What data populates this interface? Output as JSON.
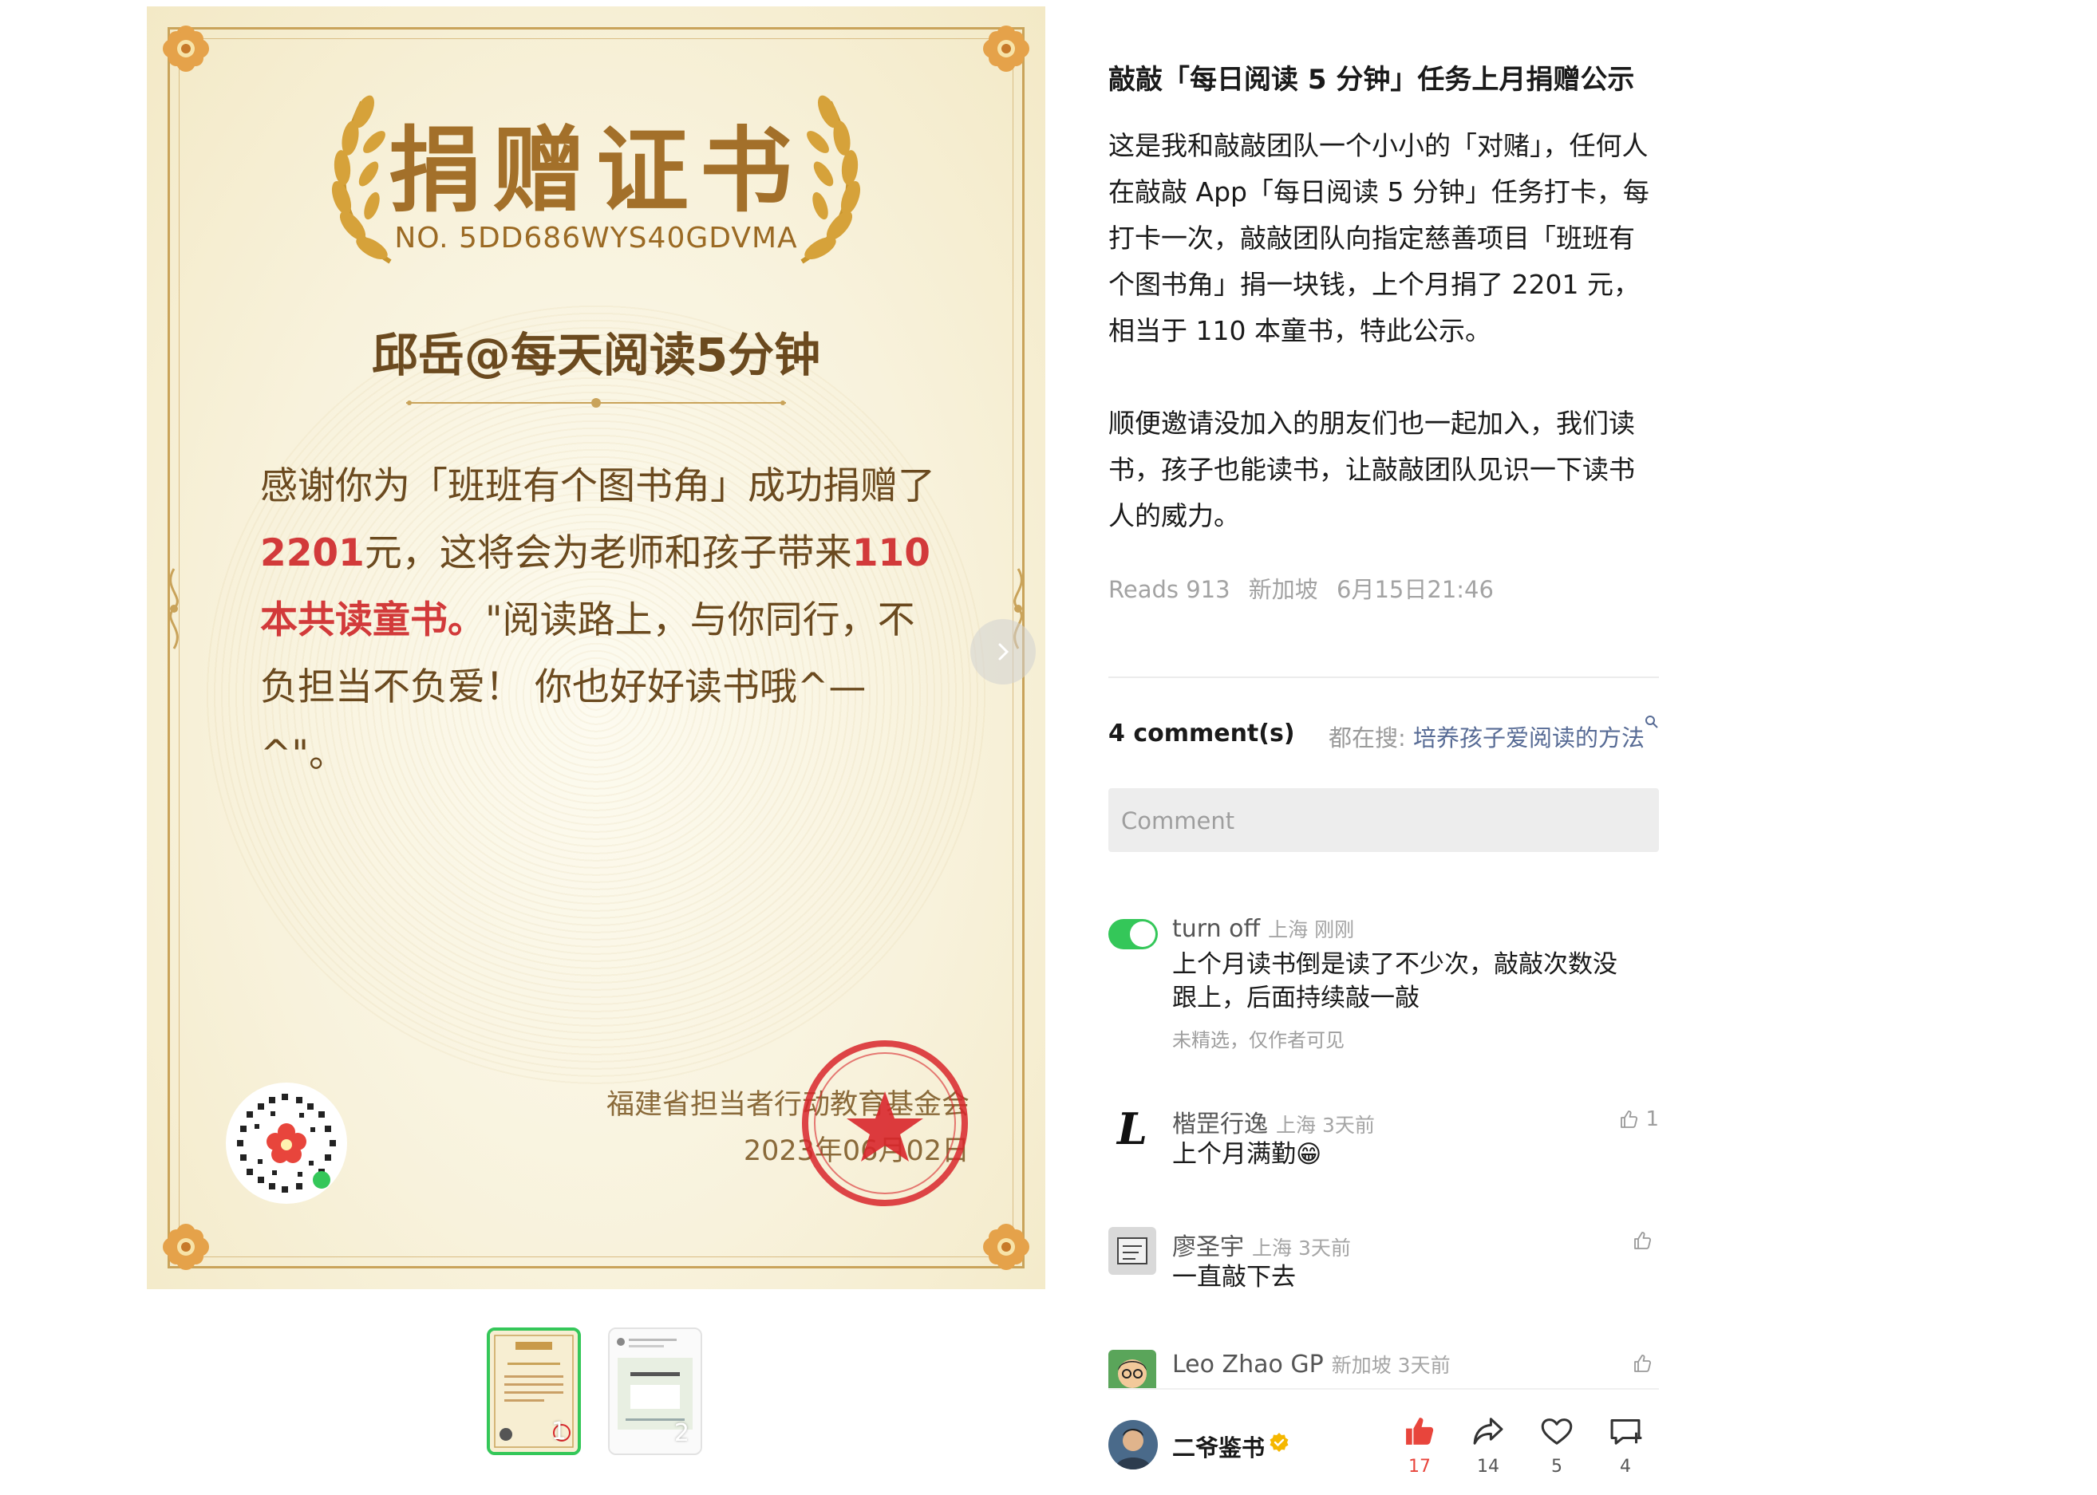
{
  "certificate": {
    "title": "捐赠证书",
    "number": "NO. 5DD686WYS40GDVMA",
    "recipient": "邱岳@每天阅读5分钟",
    "body_1": "感谢你为「班班有个图书角」成功捐赠了",
    "amount": "2201",
    "body_2": "元，这将会为老师和孩子带来",
    "books": "110本共读童书。",
    "body_3": "\"阅读路上，与你同行，不负担当不负爱！ 你也好好读书哦^—^\"。",
    "org": "福建省担当者行动教育基金会",
    "date": "2023年06月02日",
    "colors": {
      "gold": "#a3702a",
      "red": "#d23a3a"
    }
  },
  "thumbnails": [
    {
      "index": "1",
      "active": true
    },
    {
      "index": "2",
      "active": false
    }
  ],
  "post": {
    "title": "敲敲「每日阅读 5 分钟」任务上月捐赠公示",
    "paragraph_1": "这是我和敲敲团队一个小小的「对赌」，任何人在敲敲 App「每日阅读 5 分钟」任务打卡，每打卡一次，敲敲团队向指定慈善项目「班班有个图书角」捐一块钱，上个月捐了 2201 元，相当于 110 本童书，特此公示。",
    "paragraph_2": "顺便邀请没加入的朋友们也一起加入，我们读书，孩子也能读书，让敲敲团队见识一下读书人的威力。",
    "reads": "Reads 913",
    "location": "新加坡",
    "time": "6月15日21:46"
  },
  "comments_section": {
    "count": "4 comment(s)",
    "search_prefix": "都在搜: ",
    "search_keyword": "培养孩子爱阅读的方法",
    "input_placeholder": "Comment",
    "items": [
      {
        "name": "turn off",
        "location": "上海 刚刚",
        "text": "上个月读书倒是读了不少次，敲敲次数没跟上，后面持续敲一敲",
        "note": "未精选，仅作者可见",
        "likes": ""
      },
      {
        "name": "楷罡行逸",
        "location": "上海 3天前",
        "text": "上个月满勤😁",
        "likes": "1"
      },
      {
        "name": "廖圣宇",
        "location": "上海 3天前",
        "text": "一直敲下去",
        "likes": ""
      },
      {
        "name": "Leo Zhao GP",
        "location": "新加坡 3天前",
        "text": "",
        "likes": ""
      }
    ]
  },
  "bottom_bar": {
    "author": "二爷鉴书",
    "like_count": "17",
    "share_count": "14",
    "favorite_count": "5",
    "comment_count": "4",
    "accent_like": "#e8453c"
  }
}
